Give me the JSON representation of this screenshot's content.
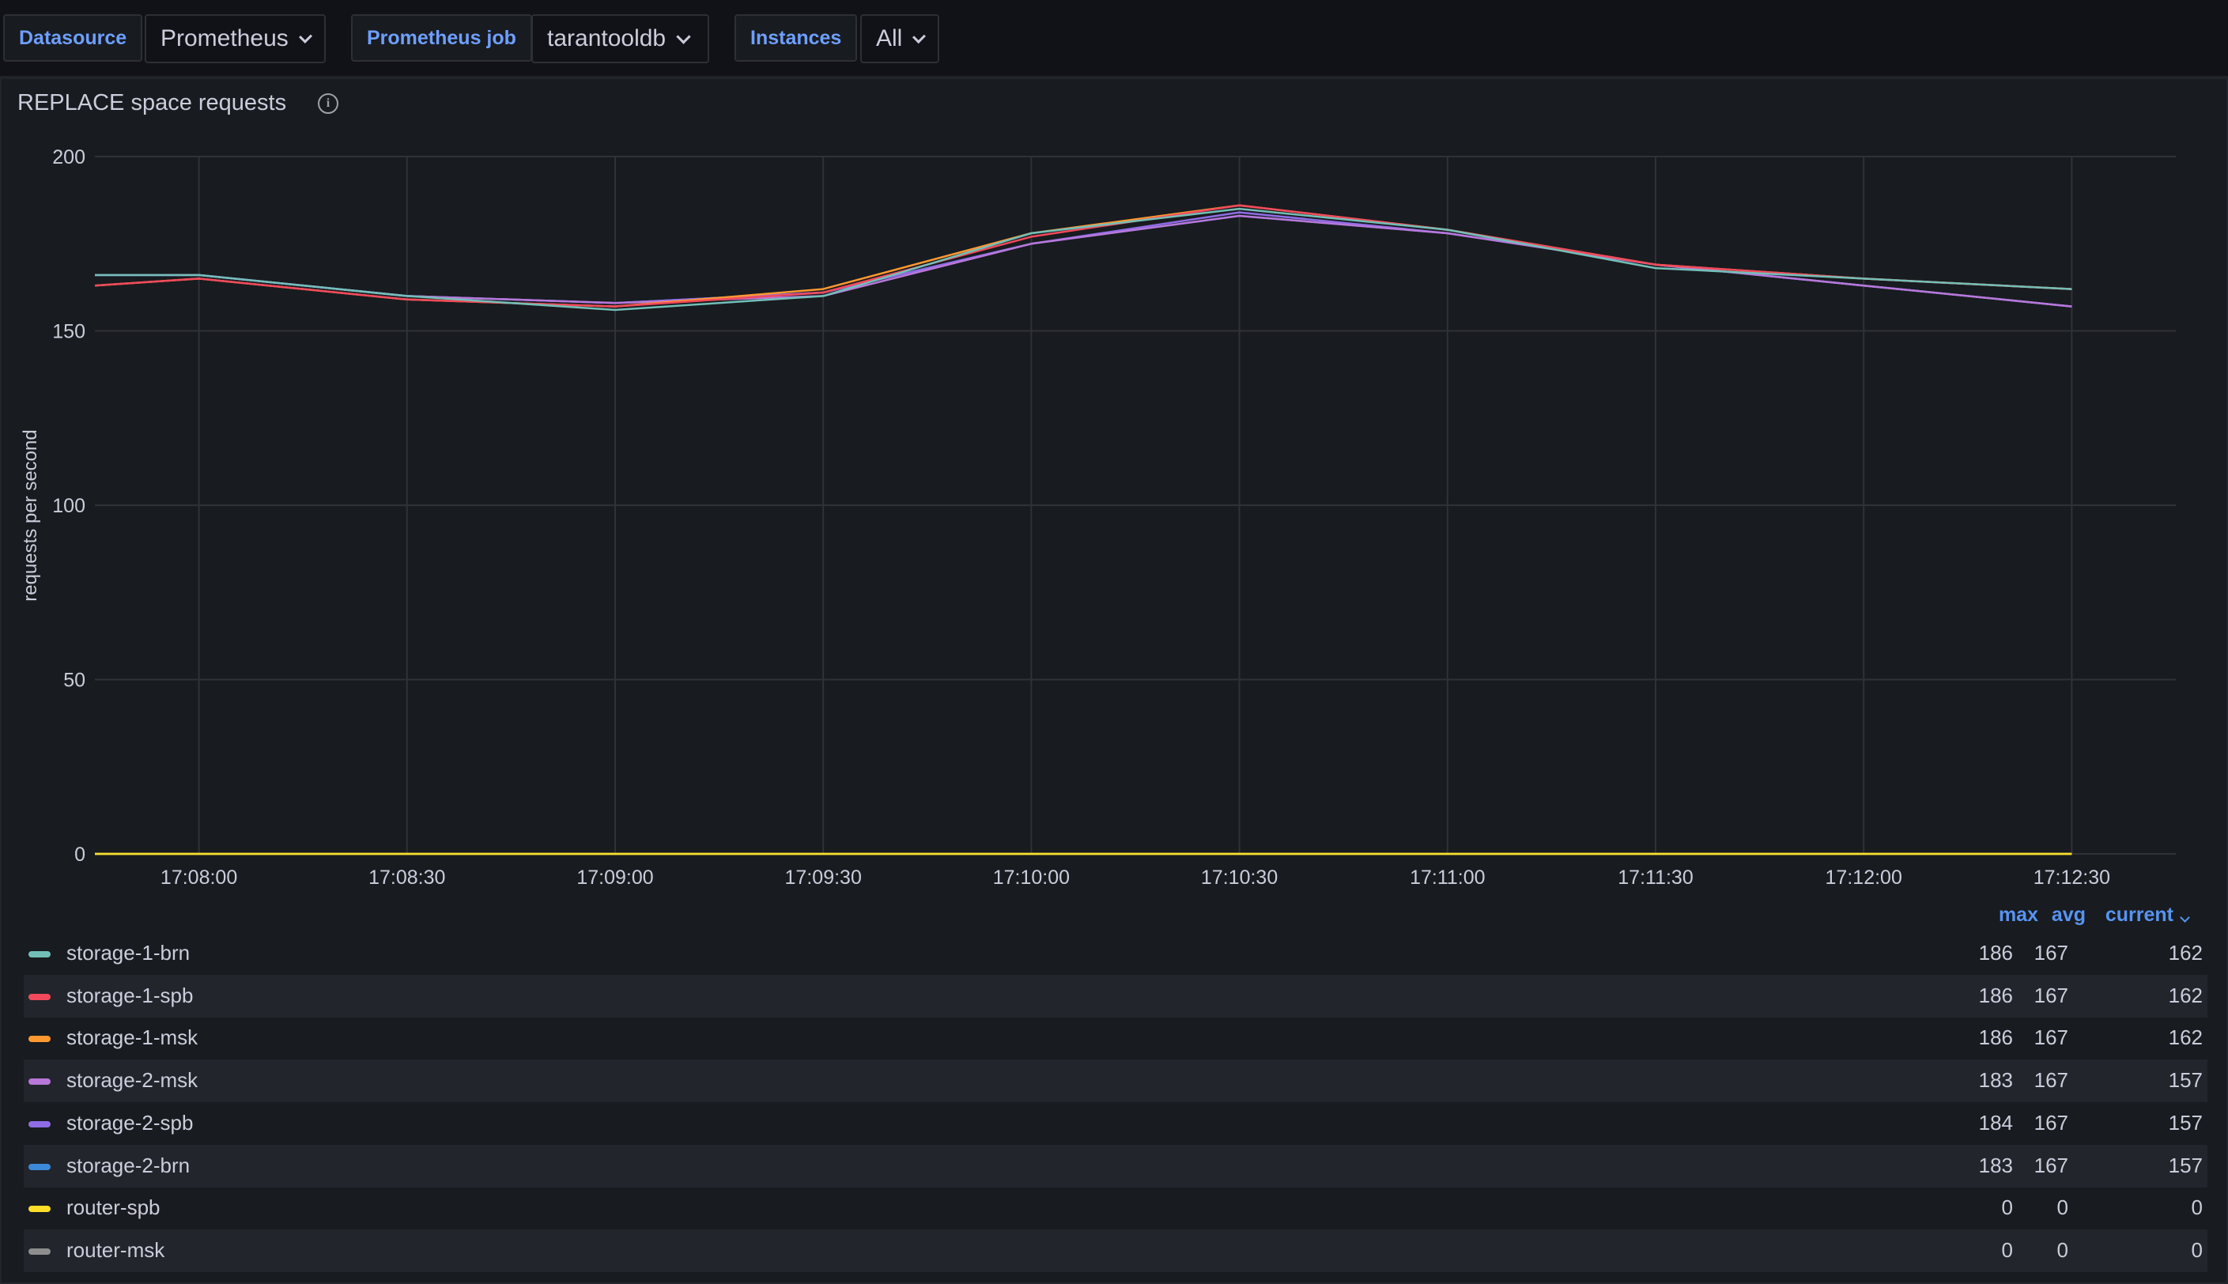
{
  "variables": [
    {
      "label": "Datasource",
      "value": "Prometheus"
    },
    {
      "label": "Prometheus job",
      "value": "tarantooldb"
    },
    {
      "label": "Instances",
      "value": "All"
    }
  ],
  "panel": {
    "title": "REPLACE space requests",
    "info_icon": "info-circle-icon"
  },
  "legend": {
    "headers": {
      "max": "max",
      "avg": "avg",
      "current": "current"
    }
  },
  "chart_data": {
    "type": "line",
    "ylabel": "requests per second",
    "ylim": [
      0,
      200
    ],
    "yticks": [
      "0",
      "50",
      "100",
      "150",
      "200"
    ],
    "xlim": [
      "17:07:45",
      "17:12:45"
    ],
    "x": [
      "17:07:45",
      "17:08:00",
      "17:08:30",
      "17:09:00",
      "17:09:30",
      "17:10:00",
      "17:10:30",
      "17:11:00",
      "17:11:30",
      "17:12:00",
      "17:12:30"
    ],
    "xticks": [
      "17:08:00",
      "17:08:30",
      "17:09:00",
      "17:09:30",
      "17:10:00",
      "17:10:30",
      "17:11:00",
      "17:11:30",
      "17:12:00",
      "17:12:30"
    ],
    "grid": true,
    "legend_position": "bottom",
    "series": [
      {
        "name": "storage-1-brn",
        "color": "#73bfb8",
        "values": [
          166,
          166,
          160,
          156,
          160,
          178,
          185,
          179,
          168,
          165,
          162
        ],
        "max": "186",
        "avg": "167",
        "current": "162"
      },
      {
        "name": "storage-1-spb",
        "color": "#f2495c",
        "values": [
          163,
          165,
          159,
          157,
          161,
          177,
          186,
          179,
          169,
          165,
          162
        ],
        "max": "186",
        "avg": "167",
        "current": "162"
      },
      {
        "name": "storage-1-msk",
        "color": "#ff9830",
        "values": [
          163,
          165,
          159,
          157,
          162,
          178,
          186,
          179,
          169,
          165,
          162
        ],
        "max": "186",
        "avg": "167",
        "current": "162"
      },
      {
        "name": "storage-2-msk",
        "color": "#b877d9",
        "values": [
          166,
          166,
          160,
          158,
          160,
          175,
          183,
          178,
          169,
          163,
          157
        ],
        "max": "183",
        "avg": "167",
        "current": "157"
      },
      {
        "name": "storage-2-spb",
        "color": "#8f6ce6",
        "values": [
          166,
          166,
          160,
          158,
          161,
          175,
          184,
          178,
          169,
          163,
          157
        ],
        "max": "184",
        "avg": "167",
        "current": "157"
      },
      {
        "name": "storage-2-brn",
        "color": "#3d89d9",
        "values": [
          166,
          166,
          160,
          158,
          161,
          175,
          183,
          178,
          169,
          163,
          157
        ],
        "max": "183",
        "avg": "167",
        "current": "157"
      },
      {
        "name": "router-spb",
        "color": "#fade2a",
        "values": [
          0,
          0,
          0,
          0,
          0,
          0,
          0,
          0,
          0,
          0,
          0
        ],
        "max": "0",
        "avg": "0",
        "current": "0"
      },
      {
        "name": "router-msk",
        "color": "#8e8e8e",
        "values": [
          0,
          0,
          0,
          0,
          0,
          0,
          0,
          0,
          0,
          0,
          0
        ],
        "max": "0",
        "avg": "0",
        "current": "0"
      }
    ]
  }
}
